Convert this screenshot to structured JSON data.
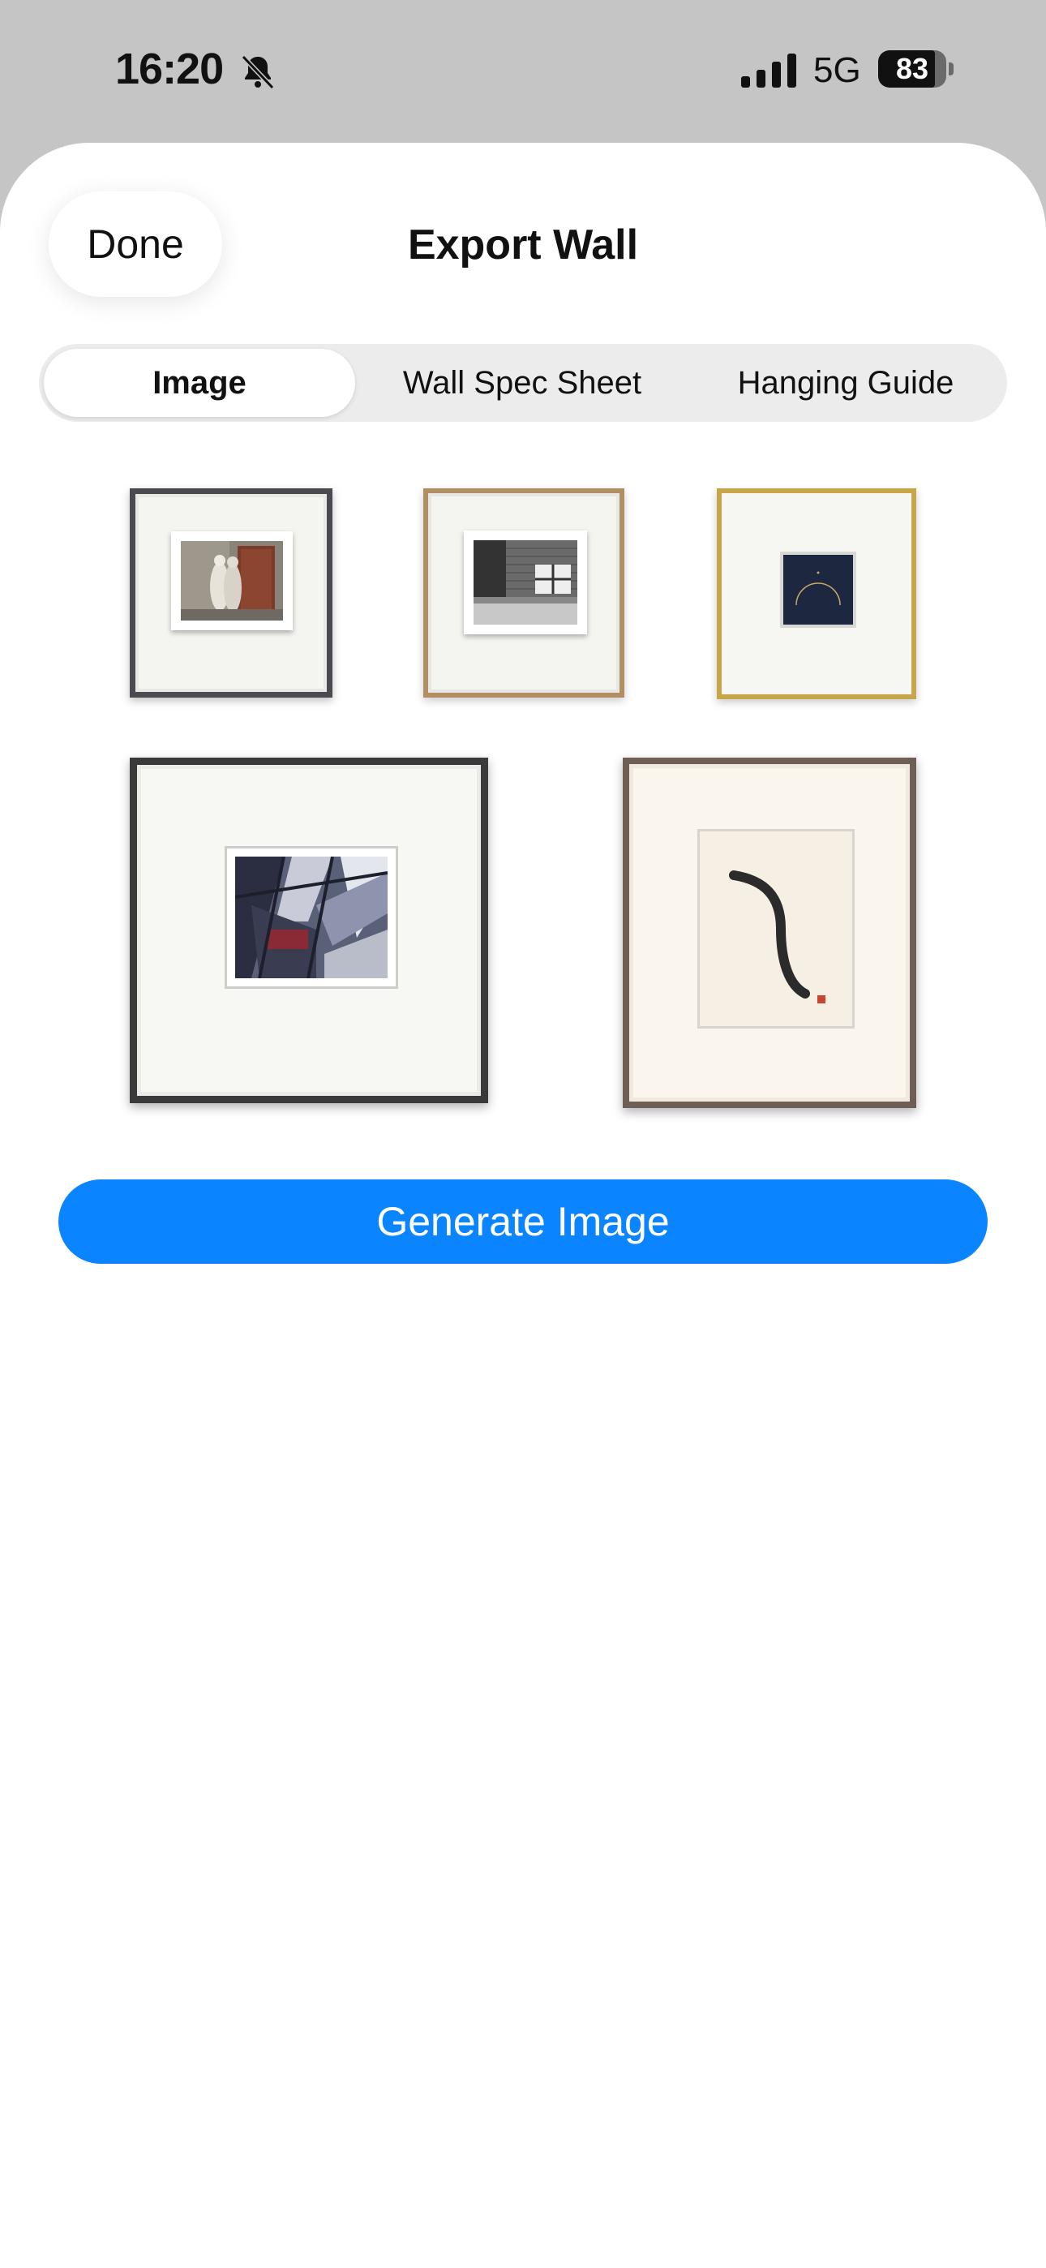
{
  "status_bar": {
    "time": "16:20",
    "network": "5G",
    "battery_percent": "83",
    "battery_level": 0.83,
    "icons": [
      "bell-slash-icon",
      "cellular-signal-icon",
      "battery-icon"
    ]
  },
  "header": {
    "done_label": "Done",
    "title": "Export Wall"
  },
  "segments": [
    {
      "label": "Image",
      "selected": true
    },
    {
      "label": "Wall Spec Sheet",
      "selected": false
    },
    {
      "label": "Hanging Guide",
      "selected": false
    }
  ],
  "artworks": [
    {
      "name": "statue-doorway-photo",
      "frame_color": "#4a4a50"
    },
    {
      "name": "brick-building-photo",
      "frame_color": "#b38e63"
    },
    {
      "name": "navy-arc-print",
      "frame_color": "#c7a54a"
    },
    {
      "name": "architecture-photo",
      "frame_color": "#3a3a3a"
    },
    {
      "name": "brush-stroke-print",
      "frame_color": "#6e5e55"
    }
  ],
  "generate_label": "Generate Image",
  "colors": {
    "accent": "#0a84ff",
    "sheet_bg": "#ffffff",
    "backdrop": "#c5c5c5"
  }
}
